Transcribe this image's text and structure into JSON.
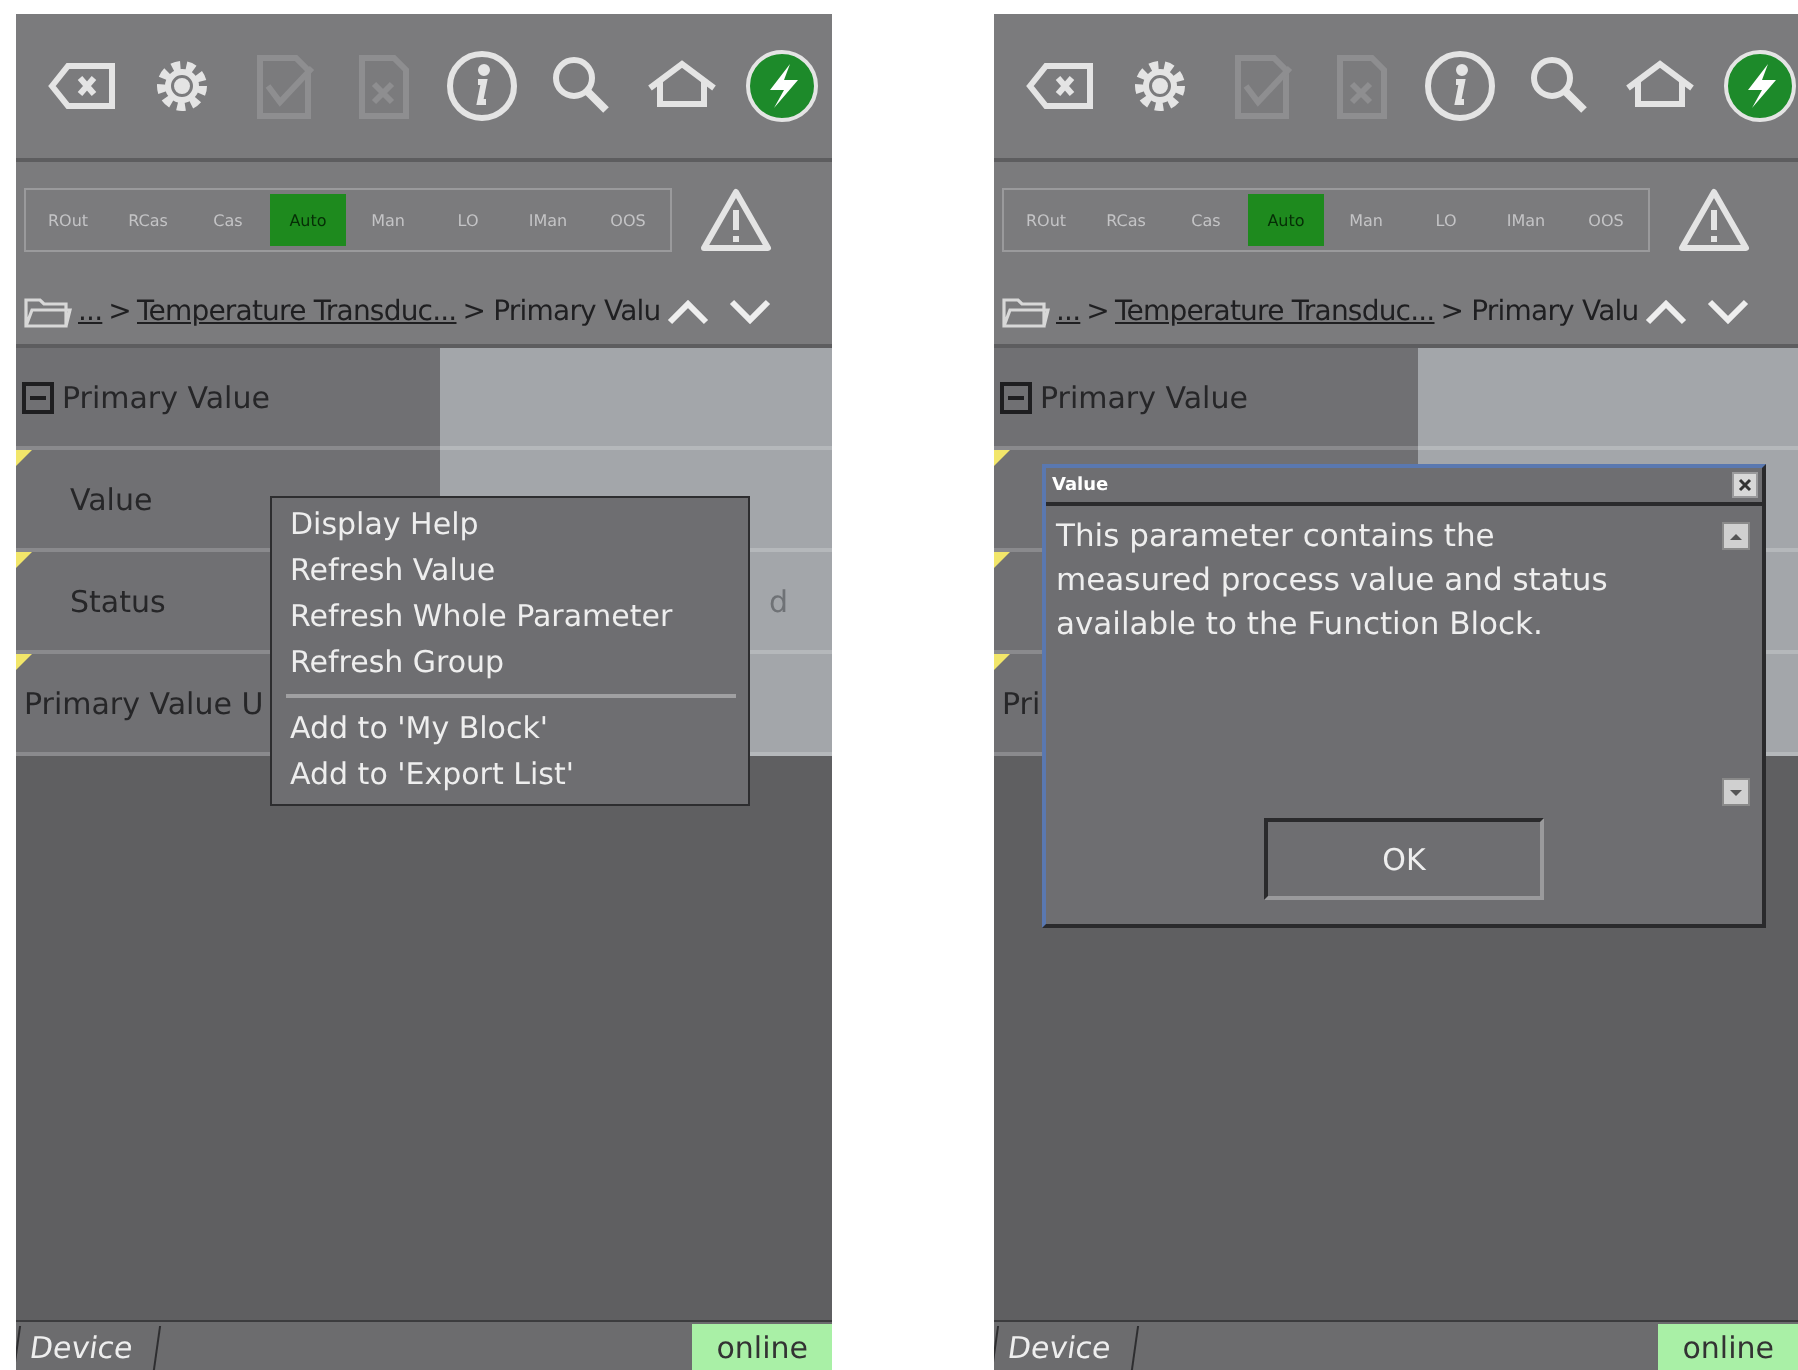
{
  "panels": [
    {
      "toolbar": [
        {
          "kind": "backspace",
          "disabled": false
        },
        {
          "kind": "gear",
          "disabled": false
        },
        {
          "kind": "check-doc",
          "disabled": true
        },
        {
          "kind": "x-doc",
          "disabled": true
        },
        {
          "kind": "info",
          "disabled": false
        },
        {
          "kind": "search",
          "disabled": false
        },
        {
          "kind": "home",
          "disabled": false
        },
        {
          "kind": "power",
          "disabled": false
        }
      ],
      "modes": [
        {
          "label": "ROut",
          "selected": false
        },
        {
          "label": "RCas",
          "selected": false
        },
        {
          "label": "Cas",
          "selected": false
        },
        {
          "label": "Auto",
          "selected": true
        },
        {
          "label": "Man",
          "selected": false
        },
        {
          "label": "LO",
          "selected": false
        },
        {
          "label": "IMan",
          "selected": false
        },
        {
          "label": "OOS",
          "selected": false
        }
      ],
      "breadcrumb": [
        {
          "text": "...",
          "link": true
        },
        {
          "text": ">",
          "link": false
        },
        {
          "text": "Temperature Transduc...",
          "link": true
        },
        {
          "text": "> Primary Valu",
          "link": false
        }
      ],
      "tree": [
        {
          "label": "Primary Value",
          "expanded": true,
          "children": [
            {
              "label": "Value",
              "marker": true
            },
            {
              "label": "Status",
              "marker": true,
              "value": "d"
            }
          ]
        },
        {
          "label": "Primary Value U",
          "marker": true
        }
      ],
      "menu": {
        "groups": [
          [
            "Display Help",
            "Refresh Value",
            "Refresh Whole Parameter",
            "Refresh Group"
          ],
          [
            "Add to 'My Block'",
            "Add to 'Export List'"
          ]
        ]
      },
      "tab": "Device",
      "status": "online"
    },
    {
      "toolbar": [
        {
          "kind": "backspace",
          "disabled": false
        },
        {
          "kind": "gear",
          "disabled": false
        },
        {
          "kind": "check-doc",
          "disabled": true
        },
        {
          "kind": "x-doc",
          "disabled": true
        },
        {
          "kind": "info",
          "disabled": false
        },
        {
          "kind": "search",
          "disabled": false
        },
        {
          "kind": "home",
          "disabled": false
        },
        {
          "kind": "power",
          "disabled": false
        }
      ],
      "modes": [
        {
          "label": "ROut",
          "selected": false
        },
        {
          "label": "RCas",
          "selected": false
        },
        {
          "label": "Cas",
          "selected": false
        },
        {
          "label": "Auto",
          "selected": true
        },
        {
          "label": "Man",
          "selected": false
        },
        {
          "label": "LO",
          "selected": false
        },
        {
          "label": "IMan",
          "selected": false
        },
        {
          "label": "OOS",
          "selected": false
        }
      ],
      "breadcrumb": [
        {
          "text": "...",
          "link": true
        },
        {
          "text": ">",
          "link": false
        },
        {
          "text": "Temperature Transduc...",
          "link": true
        },
        {
          "text": "> Primary Valu",
          "link": false
        }
      ],
      "tree": [
        {
          "label": "Primary Value",
          "expanded": true,
          "children": [
            {
              "marker": true
            },
            {
              "marker": true
            }
          ]
        },
        {
          "label": "Pri",
          "marker": true
        }
      ],
      "dialog": {
        "title": "Value",
        "text": "This parameter contains the measured process value and status available to the Function Block.",
        "button": "OK"
      },
      "tab": "Device",
      "status": "online"
    }
  ]
}
